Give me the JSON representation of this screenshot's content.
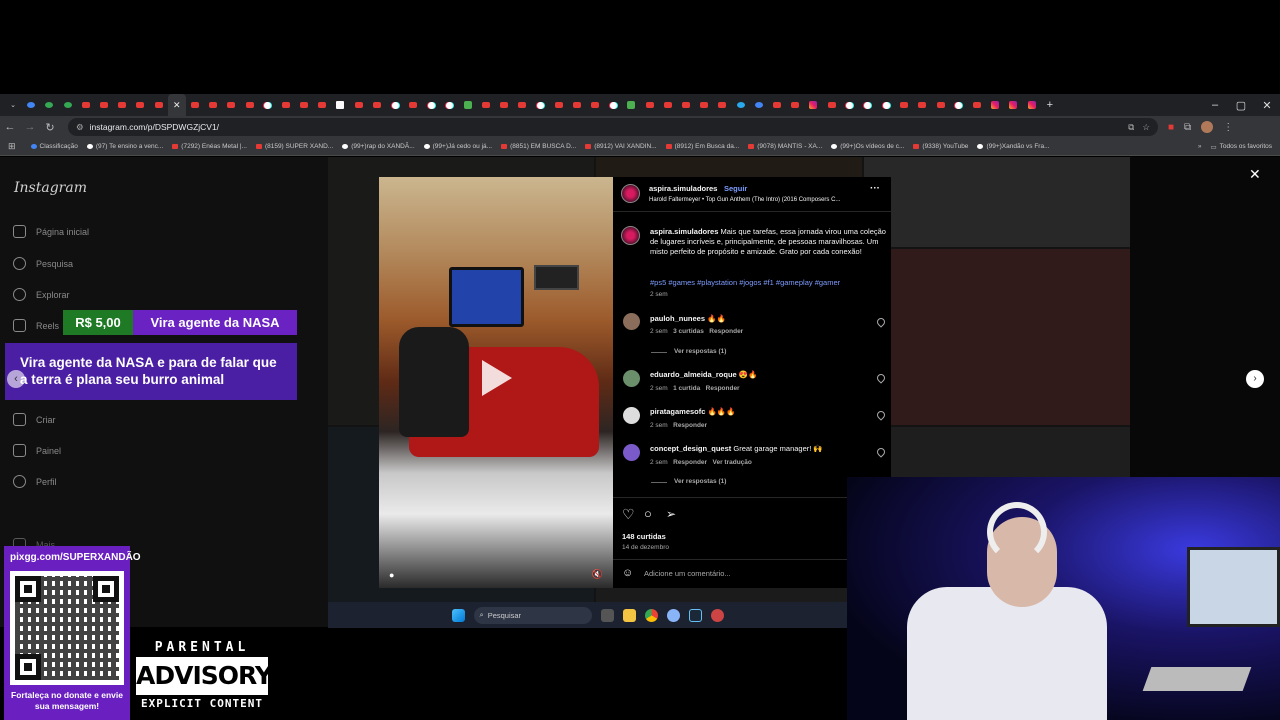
{
  "browser": {
    "url": "instagram.com/p/DSPDWGZjCV1/",
    "window_controls": [
      "–",
      "▢",
      "✕"
    ],
    "bookmarks": [
      {
        "label": "Classificação",
        "icon": "globe-icon"
      },
      {
        "label": "(97) Te ensino a venc...",
        "icon": "tiktok-icon"
      },
      {
        "label": "(7292) Enéas Metal |...",
        "icon": "youtube-icon"
      },
      {
        "label": "(8159) SUPER XAND...",
        "icon": "youtube-icon"
      },
      {
        "label": "(99+)rap do XANDÃ...",
        "icon": "tiktok-icon"
      },
      {
        "label": "(99+)Já cedo ou já...",
        "icon": "tiktok-icon"
      },
      {
        "label": "(8851) EM BUSCA D...",
        "icon": "youtube-icon"
      },
      {
        "label": "(8912) VAI XANDIN...",
        "icon": "youtube-icon"
      },
      {
        "label": "(8912) Em Busca da...",
        "icon": "youtube-icon"
      },
      {
        "label": "(9078) MANTIS - XA...",
        "icon": "youtube-icon"
      },
      {
        "label": "(99+)Os vídeos de c...",
        "icon": "tiktok-icon"
      },
      {
        "label": "(9338) YouTube",
        "icon": "youtube-icon"
      },
      {
        "label": "(99+)Xandão vs Fra...",
        "icon": "tiktok-icon"
      }
    ],
    "all_favorites": "Todos os favoritos"
  },
  "instagram": {
    "logo": "Instagram",
    "nav": [
      {
        "label": "Página inicial",
        "icon": "home-icon"
      },
      {
        "label": "Pesquisa",
        "icon": "search-icon"
      },
      {
        "label": "Explorar",
        "icon": "compass-icon"
      },
      {
        "label": "Reels",
        "icon": "reels-icon"
      },
      {
        "label": "Criar",
        "icon": "plus-icon"
      },
      {
        "label": "Painel",
        "icon": "dashboard-icon"
      },
      {
        "label": "Perfil",
        "icon": "profile-icon"
      },
      {
        "label": "Mais",
        "icon": "menu-icon"
      }
    ],
    "post": {
      "author": "aspira.simuladores",
      "follow": "Seguir",
      "separator": "•",
      "audio": "Harold Faltermeyer • Top Gun Anthem (The Intro) (2016 Composers C...",
      "caption": "Mais que tarefas, essa jornada virou uma coleção de lugares incríveis e, principalmente, de pessoas maravilhosas. Um misto perfeito de propósito e amizade. Grato por cada conexão!",
      "hashtags": "#ps5 #games #playstation #jogos #f1 #gameplay #gamer",
      "caption_time": "2 sem",
      "likes": "148 curtidas",
      "date": "14 de dezembro",
      "add_comment": "Adicione um comentário..."
    },
    "comments": [
      {
        "user": "pauloh_nunees",
        "text": "🔥🔥",
        "time": "2 sem",
        "likes": "3 curtidas",
        "reply": "Responder",
        "view_replies": "Ver respostas (1)"
      },
      {
        "user": "eduardo_almeida_roque",
        "text": "😍🔥",
        "time": "2 sem",
        "likes": "1 curtida",
        "reply": "Responder",
        "view_replies": ""
      },
      {
        "user": "piratagamesofc",
        "text": "🔥🔥🔥",
        "time": "2 sem",
        "likes": "",
        "reply": "Responder",
        "view_replies": ""
      },
      {
        "user": "concept_design_quest",
        "text": "Great garage manager! 🙌",
        "time": "2 sem",
        "likes": "",
        "reply": "Responder",
        "translate": "Ver tradução",
        "view_replies": "Ver respostas (1)"
      }
    ]
  },
  "taskbar": {
    "search_placeholder": "Pesquisar"
  },
  "overlay": {
    "promo_price": "R$ 5,00",
    "promo_title": "Vira agente da NASA",
    "promo_message": "Vira agente da NASA e para de falar que a terra é plana seu burro animal",
    "pix_url": "pixgg.com/SUPERXANDÃO",
    "pix_message": "Fortaleça no donate e envie sua mensagem!",
    "advisory_top": "PARENTAL",
    "advisory_mid": "ADVISORY",
    "advisory_bot": "EXPLICIT CONTENT"
  },
  "colors": {
    "accent": "#0095f6",
    "promo_green": "#1f7a26",
    "promo_purple": "#6a22c3"
  }
}
